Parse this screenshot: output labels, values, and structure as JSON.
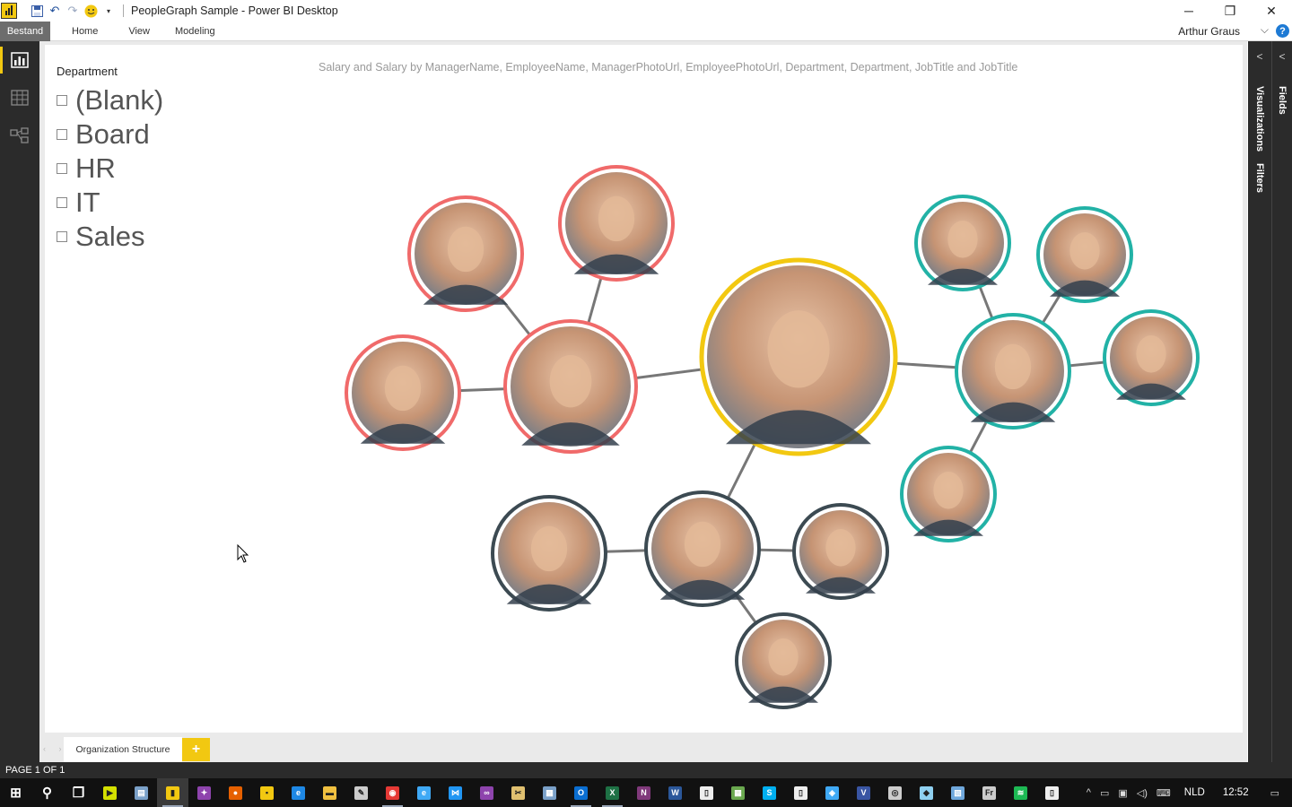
{
  "window": {
    "title": "PeopleGraph Sample - Power BI Desktop",
    "controls": {
      "minimize": "─",
      "restore": "❐",
      "close": "✕"
    }
  },
  "ribbon": {
    "file_tab": "Bestand",
    "tabs": [
      "Home",
      "View",
      "Modeling"
    ],
    "user": "Arthur Graus",
    "help": "?"
  },
  "slicer": {
    "title": "Department",
    "items": [
      "(Blank)",
      "Board",
      "HR",
      "IT",
      "Sales"
    ]
  },
  "visual": {
    "title": "Salary and Salary by ManagerName, EmployeeName, ManagerPhotoUrl, EmployeePhotoUrl, Department, Department, JobTitle and JobTitle"
  },
  "people_graph": {
    "colors": {
      "root": "#f2c811",
      "red_group": "#f06a6a",
      "teal_group": "#22b2a6",
      "dark_group": "#3c4a52"
    },
    "nodes": [
      {
        "id": "root",
        "group": "root"
      },
      {
        "id": "red-manager",
        "group": "red_group"
      },
      {
        "id": "red-woman",
        "group": "red_group"
      },
      {
        "id": "red-man-top",
        "group": "red_group"
      },
      {
        "id": "red-man-left",
        "group": "red_group"
      },
      {
        "id": "teal-manager",
        "group": "teal_group"
      },
      {
        "id": "teal-a",
        "group": "teal_group"
      },
      {
        "id": "teal-b",
        "group": "teal_group"
      },
      {
        "id": "teal-c",
        "group": "teal_group"
      },
      {
        "id": "teal-d",
        "group": "teal_group"
      },
      {
        "id": "dark-manager",
        "group": "dark_group"
      },
      {
        "id": "dark-left",
        "group": "dark_group"
      },
      {
        "id": "dark-right",
        "group": "dark_group"
      },
      {
        "id": "dark-bottom",
        "group": "dark_group"
      }
    ]
  },
  "right_panes": {
    "visualizations": "Visualizations",
    "filters": "Filters",
    "fields": "Fields"
  },
  "page_tabs": {
    "tabs": [
      "Organization Structure"
    ],
    "add": "+"
  },
  "status": "PAGE 1 OF 1",
  "taskbar": {
    "apps": [
      {
        "name": "start",
        "color": "#ffffff",
        "glyph": "⊞"
      },
      {
        "name": "search",
        "color": "#ffffff",
        "glyph": "⚲"
      },
      {
        "name": "task-view",
        "color": "#ffffff",
        "glyph": "❐"
      },
      {
        "name": "media",
        "color": "#d4e000",
        "glyph": "▶"
      },
      {
        "name": "notes",
        "color": "#7aa0c8",
        "glyph": "▤"
      },
      {
        "name": "power-bi",
        "color": "#f2c811",
        "glyph": "▮"
      },
      {
        "name": "app-purple",
        "color": "#8e44ad",
        "glyph": "✦"
      },
      {
        "name": "firefox",
        "color": "#e66000",
        "glyph": "●"
      },
      {
        "name": "sticky",
        "color": "#f2c811",
        "glyph": "▪"
      },
      {
        "name": "edge",
        "color": "#1e88e5",
        "glyph": "e"
      },
      {
        "name": "explorer",
        "color": "#f0c040",
        "glyph": "▬"
      },
      {
        "name": "tool",
        "color": "#cccccc",
        "glyph": "✎"
      },
      {
        "name": "chrome",
        "color": "#e53935",
        "glyph": "◉"
      },
      {
        "name": "ie",
        "color": "#3fa9f5",
        "glyph": "e"
      },
      {
        "name": "vscode",
        "color": "#2196f3",
        "glyph": "⋈"
      },
      {
        "name": "visual-studio",
        "color": "#8e44ad",
        "glyph": "∞"
      },
      {
        "name": "tools",
        "color": "#e0c070",
        "glyph": "✂"
      },
      {
        "name": "pc",
        "color": "#7aa0c8",
        "glyph": "▦"
      },
      {
        "name": "outlook",
        "color": "#0a6ed1",
        "glyph": "O"
      },
      {
        "name": "excel",
        "color": "#1e7145",
        "glyph": "X"
      },
      {
        "name": "onenote",
        "color": "#80397b",
        "glyph": "N"
      },
      {
        "name": "word",
        "color": "#2b579a",
        "glyph": "W"
      },
      {
        "name": "file-a",
        "color": "#eeeeee",
        "glyph": "▯"
      },
      {
        "name": "sheet",
        "color": "#6aa84f",
        "glyph": "▦"
      },
      {
        "name": "skype",
        "color": "#00aff0",
        "glyph": "S"
      },
      {
        "name": "file-b",
        "color": "#eeeeee",
        "glyph": "▯"
      },
      {
        "name": "app-blue",
        "color": "#3fa9f5",
        "glyph": "◈"
      },
      {
        "name": "visio",
        "color": "#3955a3",
        "glyph": "V"
      },
      {
        "name": "magnifier",
        "color": "#cccccc",
        "glyph": "◎"
      },
      {
        "name": "app-cyan",
        "color": "#8fd0f0",
        "glyph": "◆"
      },
      {
        "name": "photos",
        "color": "#6fa8dc",
        "glyph": "▧"
      },
      {
        "name": "frame",
        "color": "#cccccc",
        "glyph": "Fr"
      },
      {
        "name": "spotify",
        "color": "#1db954",
        "glyph": "≋"
      },
      {
        "name": "file-c",
        "color": "#eeeeee",
        "glyph": "▯"
      }
    ],
    "tray_icons": [
      "^",
      "▭",
      "▣",
      "◁)",
      "⌨"
    ],
    "language": "NLD",
    "time": "12:52",
    "notification": "▭"
  }
}
